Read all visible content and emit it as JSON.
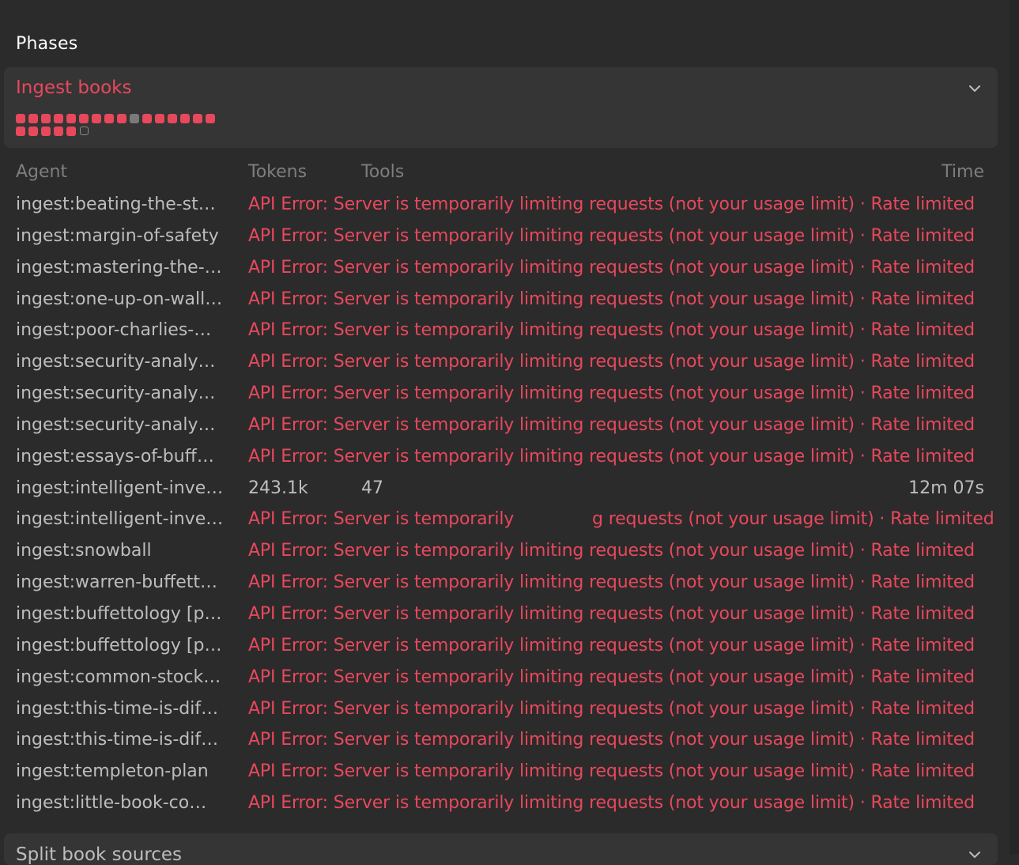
{
  "section_title": "Phases",
  "phase": {
    "name": "Ingest books",
    "status_dots": [
      "error",
      "error",
      "error",
      "error",
      "error",
      "error",
      "error",
      "error",
      "error",
      "neutral",
      "error",
      "error",
      "error",
      "error",
      "error",
      "error",
      "error",
      "error",
      "error",
      "error",
      "error",
      "pending"
    ]
  },
  "table": {
    "headers": {
      "agent": "Agent",
      "tokens": "Tokens",
      "tools": "Tools",
      "time": "Time"
    },
    "rows": [
      {
        "agent": "ingest:beating-the-st…",
        "error": "API Error: Server is temporarily limiting requests (not your usage limit) · Rate limited"
      },
      {
        "agent": "ingest:margin-of-safety",
        "error": "API Error: Server is temporarily limiting requests (not your usage limit) · Rate limited"
      },
      {
        "agent": "ingest:mastering-the-…",
        "error": "API Error: Server is temporarily limiting requests (not your usage limit) · Rate limited"
      },
      {
        "agent": "ingest:one-up-on-wall…",
        "error": "API Error: Server is temporarily limiting requests (not your usage limit) · Rate limited"
      },
      {
        "agent": "ingest:poor-charlies-…",
        "error": "API Error: Server is temporarily limiting requests (not your usage limit) · Rate limited"
      },
      {
        "agent": "ingest:security-analy…",
        "error": "API Error: Server is temporarily limiting requests (not your usage limit) · Rate limited"
      },
      {
        "agent": "ingest:security-analy…",
        "error": "API Error: Server is temporarily limiting requests (not your usage limit) · Rate limited"
      },
      {
        "agent": "ingest:security-analy…",
        "error": "API Error: Server is temporarily limiting requests (not your usage limit) · Rate limited"
      },
      {
        "agent": "ingest:essays-of-buff…",
        "error": "API Error: Server is temporarily limiting requests (not your usage limit) · Rate limited"
      },
      {
        "agent": "ingest:intelligent-inve…",
        "tokens": "243.1k",
        "tools": "47",
        "time": "12m 07s"
      },
      {
        "agent": "ingest:intelligent-inve…",
        "error_pre": "API Error: Server is temporarily ",
        "error_post": "g requests (not your usage limit) · Rate limited"
      },
      {
        "agent": "ingest:snowball",
        "error": "API Error: Server is temporarily limiting requests (not your usage limit) · Rate limited"
      },
      {
        "agent": "ingest:warren-buffett…",
        "error": "API Error: Server is temporarily limiting requests (not your usage limit) · Rate limited"
      },
      {
        "agent": "ingest:buffettology [p…",
        "error": "API Error: Server is temporarily limiting requests (not your usage limit) · Rate limited"
      },
      {
        "agent": "ingest:buffettology [p…",
        "error": "API Error: Server is temporarily limiting requests (not your usage limit) · Rate limited"
      },
      {
        "agent": "ingest:common-stock…",
        "error": "API Error: Server is temporarily limiting requests (not your usage limit) · Rate limited"
      },
      {
        "agent": "ingest:this-time-is-dif…",
        "error": "API Error: Server is temporarily limiting requests (not your usage limit) · Rate limited"
      },
      {
        "agent": "ingest:this-time-is-dif…",
        "error": "API Error: Server is temporarily limiting requests (not your usage limit) · Rate limited"
      },
      {
        "agent": "ingest:templeton-plan",
        "error": "API Error: Server is temporarily limiting requests (not your usage limit) · Rate limited"
      },
      {
        "agent": "ingest:little-book-co…",
        "error": "API Error: Server is temporarily limiting requests (not your usage limit) · Rate limited"
      }
    ]
  },
  "next_phase": {
    "name": "Split book sources"
  },
  "colors": {
    "error": "#e8485c",
    "background": "#2b2b2b",
    "card": "#353535"
  }
}
